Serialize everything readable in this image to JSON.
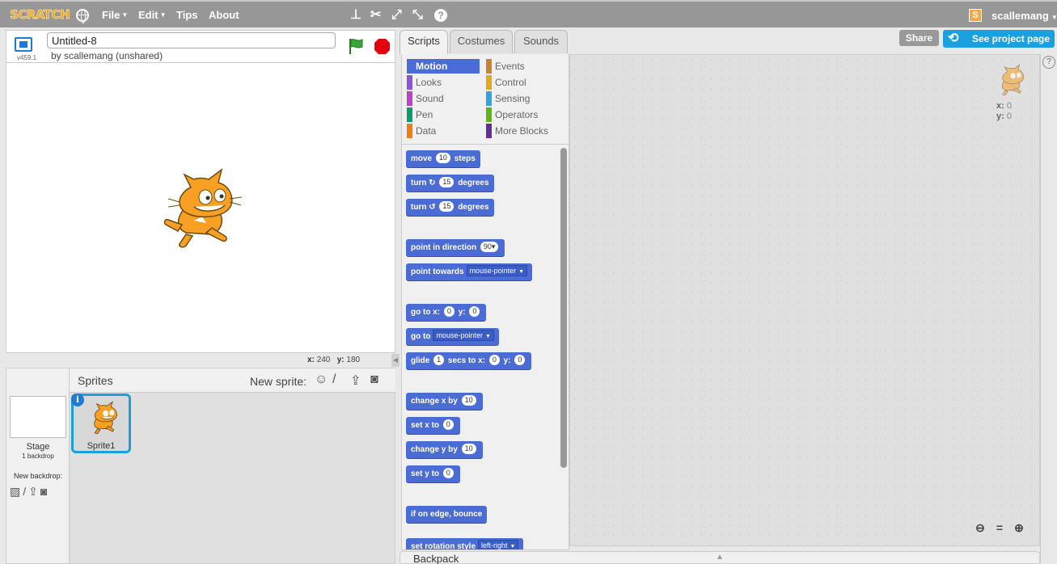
{
  "topbar": {
    "logo": "SCRATCH",
    "menus": [
      "File",
      "Edit",
      "Tips",
      "About"
    ],
    "username": "scallemang",
    "user_badge": "S",
    "help_glyph": "?"
  },
  "stage": {
    "version": "v459.1",
    "project_title": "Untitled-8",
    "byline": "by scallemang (unshared)",
    "coords": {
      "x_label": "x:",
      "x": "240",
      "y_label": "y:",
      "y": "180"
    }
  },
  "sprites": {
    "title": "Sprites",
    "new_sprite_label": "New sprite:",
    "stage_label": "Stage",
    "backdrop_count": "1 backdrop",
    "new_backdrop_label": "New backdrop:",
    "sprite_name": "Sprite1",
    "info_glyph": "i"
  },
  "tabs": [
    "Scripts",
    "Costumes",
    "Sounds"
  ],
  "actions": {
    "share": "Share",
    "see_project": "See project page"
  },
  "categories": [
    {
      "label": "Motion",
      "color": "#4a6cd4"
    },
    {
      "label": "Events",
      "color": "#c88330"
    },
    {
      "label": "Looks",
      "color": "#8a55d7"
    },
    {
      "label": "Control",
      "color": "#e1a91a"
    },
    {
      "label": "Sound",
      "color": "#bb42c3"
    },
    {
      "label": "Sensing",
      "color": "#2ca5e2"
    },
    {
      "label": "Pen",
      "color": "#0e9a6c"
    },
    {
      "label": "Operators",
      "color": "#5cb712"
    },
    {
      "label": "Data",
      "color": "#ee7d16"
    },
    {
      "label": "More Blocks",
      "color": "#632d99"
    }
  ],
  "blocks": {
    "move": {
      "a": "move",
      "v": "10",
      "b": "steps"
    },
    "turn_cw": {
      "a": "turn",
      "icon": "↻",
      "v": "15",
      "b": "degrees"
    },
    "turn_ccw": {
      "a": "turn",
      "icon": "↺",
      "v": "15",
      "b": "degrees"
    },
    "point_dir": {
      "a": "point in direction",
      "v": "90"
    },
    "point_towards": {
      "a": "point towards",
      "v": "mouse-pointer"
    },
    "goto_xy": {
      "a": "go to x:",
      "x": "0",
      "b": "y:",
      "y": "0"
    },
    "goto": {
      "a": "go to",
      "v": "mouse-pointer"
    },
    "glide": {
      "a": "glide",
      "secs": "1",
      "b": "secs to x:",
      "x": "0",
      "c": "y:",
      "y": "0"
    },
    "change_x": {
      "a": "change x by",
      "v": "10"
    },
    "set_x": {
      "a": "set x to",
      "v": "0"
    },
    "change_y": {
      "a": "change y by",
      "v": "10"
    },
    "set_y": {
      "a": "set y to",
      "v": "0"
    },
    "bounce": {
      "a": "if on edge, bounce"
    },
    "rotation": {
      "a": "set rotation style",
      "v": "left-right"
    }
  },
  "script_area": {
    "x_label": "x:",
    "x": "0",
    "y_label": "y:",
    "y": "0"
  },
  "backpack": {
    "label": "Backpack"
  }
}
